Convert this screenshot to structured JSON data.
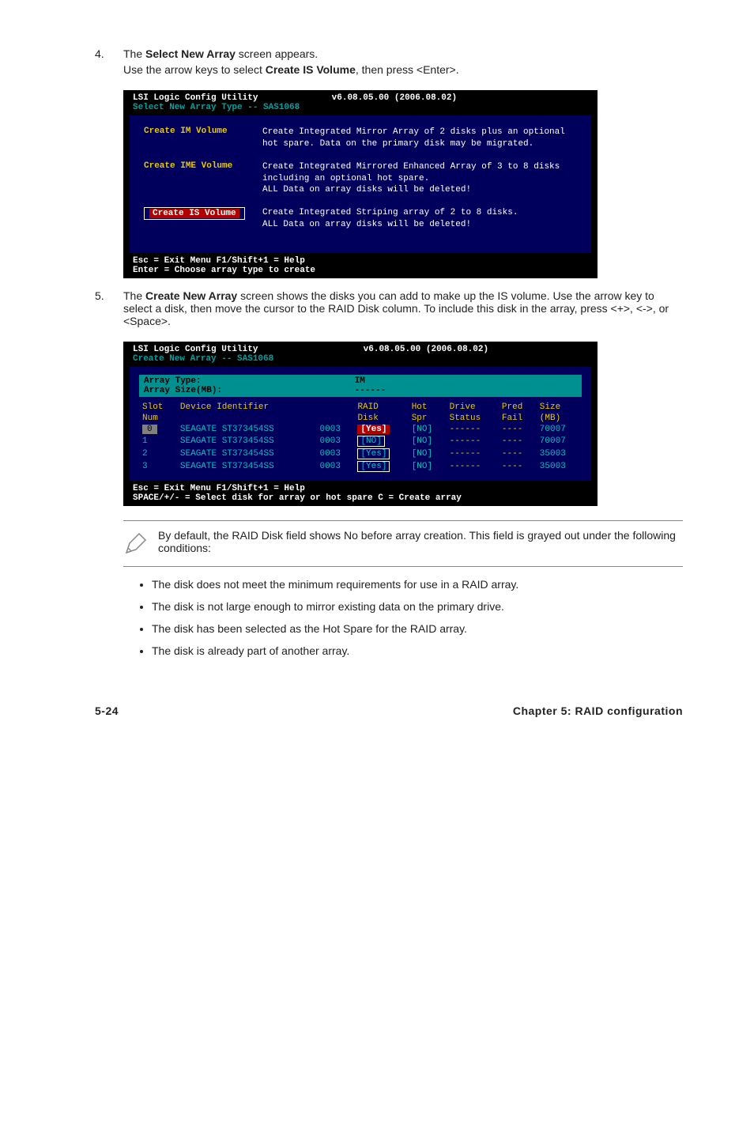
{
  "step4": {
    "num": "4.",
    "line1a": "The ",
    "line1b": "Select New Array",
    "line1c": " screen appears.",
    "line2a": "Use the arrow keys to select ",
    "line2b": "Create IS Volume",
    "line2c": ", then press <Enter>."
  },
  "term1": {
    "header_left": "LSI Logic Config Utility",
    "header_right": "v6.08.05.00 (2006.08.02)",
    "header_sub": "Select New Array Type -- SAS1068",
    "rows": [
      {
        "label": "Create IM Volume",
        "selected": false,
        "desc": "Create Integrated Mirror Array of 2 disks plus an optional hot spare. Data on the primary disk may be migrated."
      },
      {
        "label": "Create IME Volume",
        "selected": false,
        "desc": "Create Integrated Mirrored Enhanced Array of 3 to 8 disks including an optional hot spare.\nALL Data on array disks will be deleted!"
      },
      {
        "label": "Create IS Volume",
        "selected": true,
        "desc": "Create Integrated Striping array of 2 to 8 disks.\nALL Data on array disks will be deleted!"
      }
    ],
    "footer_l1": "Esc = Exit Menu    F1/Shift+1 = Help",
    "footer_l2": "Enter = Choose array type to create"
  },
  "step5": {
    "num": "5.",
    "text_a": "The ",
    "text_b": "Create New Array",
    "text_c": " screen shows the disks you can add to make up the IS volume. Use the arrow key to select a disk, then move the cursor to the RAID Disk column. To include this disk in the array, press <+>, <->, or <Space>."
  },
  "term2": {
    "header_left": "LSI Logic Config Utility",
    "header_right": "v6.08.05.00 (2006.08.02)",
    "header_sub": "Create New Array -- SAS1068",
    "title_l1": "Array Type:",
    "title_l2": "Array Size(MB):",
    "title_r": "IM",
    "title_r2": "------",
    "cols1": [
      "Slot",
      "Device Identifier",
      "",
      "RAID",
      "Hot",
      "Drive",
      "Pred",
      "Size"
    ],
    "cols2": [
      "Num",
      "",
      "",
      "Disk",
      "Spr",
      "Status",
      "Fail",
      "(MB)"
    ],
    "rows": [
      {
        "slot": "0",
        "dev": "SEAGATE ST373454SS",
        "rev": "0003",
        "raid": "[Yes]",
        "hot": "[NO]",
        "drive": "------",
        "pred": "----",
        "size": "70007",
        "sel": true
      },
      {
        "slot": "1",
        "dev": "SEAGATE ST373454SS",
        "rev": "0003",
        "raid": "[NO]",
        "hot": "[NO]",
        "drive": "------",
        "pred": "----",
        "size": "70007",
        "sel": false
      },
      {
        "slot": "2",
        "dev": "SEAGATE ST373454SS",
        "rev": "0003",
        "raid": "[Yes]",
        "hot": "[NO]",
        "drive": "------",
        "pred": "----",
        "size": "35003",
        "sel": false
      },
      {
        "slot": "3",
        "dev": "SEAGATE ST373454SS",
        "rev": "0003",
        "raid": "[Yes]",
        "hot": "[NO]",
        "drive": "------",
        "pred": "----",
        "size": "35003",
        "sel": false
      }
    ],
    "footer_l1": "Esc = Exit Menu   F1/Shift+1 = Help",
    "footer_l2": "SPACE/+/- = Select disk for array or hot spare   C = Create array"
  },
  "note": {
    "text": "By default, the RAID Disk field shows No before array creation. This field is grayed out under the following conditions:"
  },
  "bullets": [
    "The disk does not meet the minimum requirements for use in a RAID array.",
    "The disk is not large enough to mirror existing data on the primary drive.",
    "The disk has been selected as the Hot Spare for the RAID array.",
    "The disk is already part of another array."
  ],
  "footer": {
    "left": "5-24",
    "right": "Chapter 5: RAID configuration"
  }
}
